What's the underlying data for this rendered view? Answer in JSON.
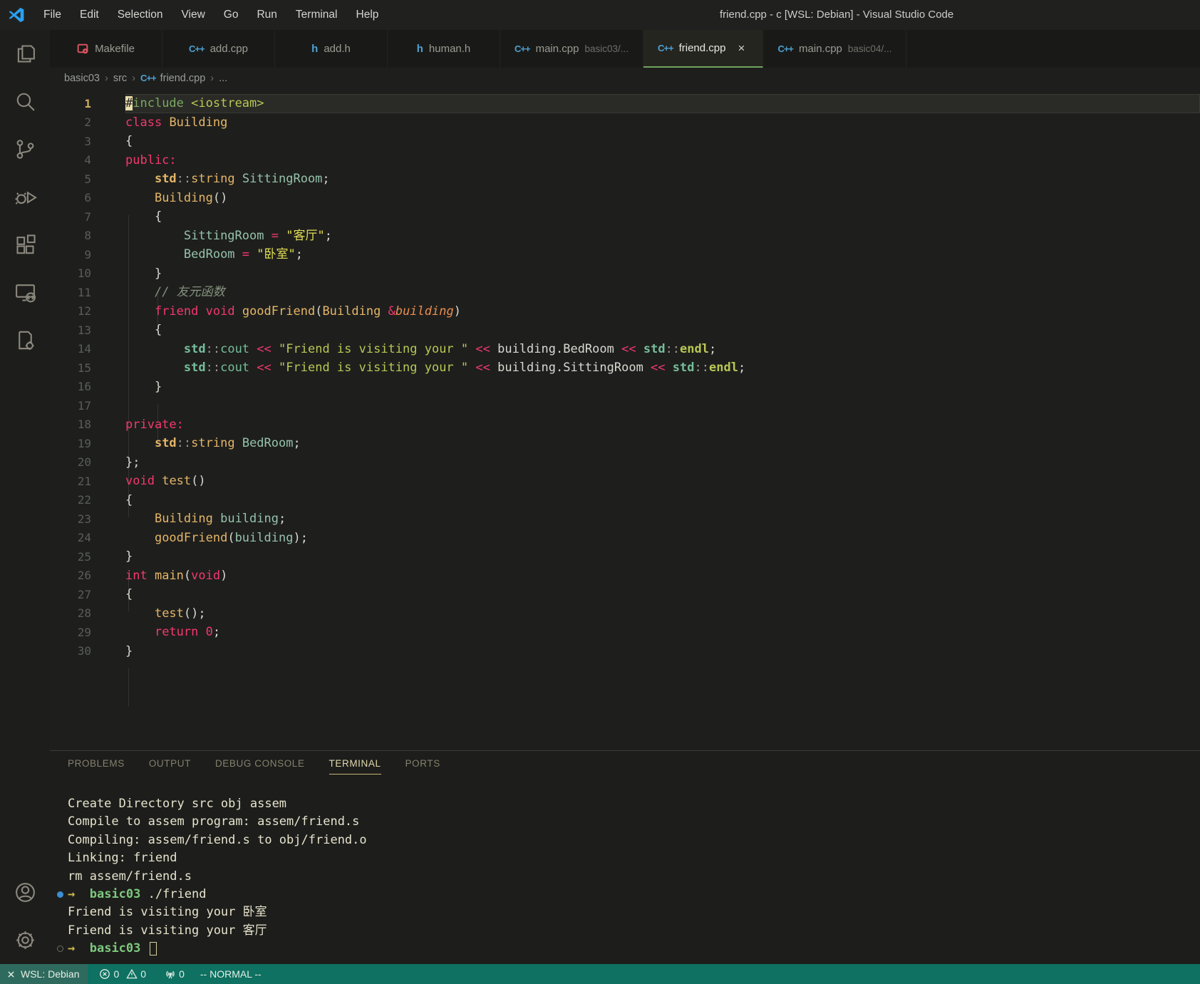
{
  "window": {
    "title": "friend.cpp - c [WSL: Debian] - Visual Studio Code"
  },
  "menus": [
    "File",
    "Edit",
    "Selection",
    "View",
    "Go",
    "Run",
    "Terminal",
    "Help"
  ],
  "activity_bar": {
    "top": [
      "explorer",
      "search",
      "source-control",
      "run-debug",
      "extensions",
      "remote-explorer",
      "cpp-tools"
    ],
    "bottom": [
      "accounts",
      "settings"
    ]
  },
  "tabs": [
    {
      "icon": "makefile",
      "label": "Makefile"
    },
    {
      "icon": "cpp",
      "label": "add.cpp"
    },
    {
      "icon": "h",
      "label": "add.h"
    },
    {
      "icon": "h",
      "label": "human.h"
    },
    {
      "icon": "cpp",
      "label": "main.cpp",
      "desc": "basic03/..."
    },
    {
      "icon": "cpp",
      "label": "friend.cpp",
      "active": true,
      "close": "×"
    },
    {
      "icon": "cpp",
      "label": "main.cpp",
      "desc": "basic04/..."
    }
  ],
  "breadcrumb": {
    "items": [
      {
        "label": "basic03"
      },
      {
        "label": "src"
      },
      {
        "label": "friend.cpp",
        "icon": "cpp"
      },
      {
        "label": "..."
      }
    ],
    "separator": "›"
  },
  "editor": {
    "first_line_number": 1,
    "current_line": 1,
    "lines": [
      [
        [
          "cur",
          "#"
        ],
        [
          "gr",
          "include"
        ],
        [
          "w",
          " "
        ],
        [
          "yg",
          "<iostream>"
        ]
      ],
      [
        [
          "r",
          "class"
        ],
        [
          "w",
          " "
        ],
        [
          "g",
          "Building"
        ]
      ],
      [
        [
          "w",
          "{"
        ]
      ],
      [
        [
          "r",
          "public:"
        ]
      ],
      [
        [
          "w",
          "    "
        ],
        [
          "gb",
          "std"
        ],
        [
          "gy",
          "::"
        ],
        [
          "g",
          "string"
        ],
        [
          "w",
          " "
        ],
        [
          "t",
          "SittingRoom"
        ],
        [
          "w",
          ";"
        ]
      ],
      [
        [
          "w",
          "    "
        ],
        [
          "g",
          "Building"
        ],
        [
          "w",
          "()"
        ]
      ],
      [
        [
          "w",
          "    {"
        ]
      ],
      [
        [
          "w",
          "        "
        ],
        [
          "t",
          "SittingRoom"
        ],
        [
          "w",
          " "
        ],
        [
          "r",
          "="
        ],
        [
          "w",
          " "
        ],
        [
          "y",
          "\"客厅\""
        ],
        [
          "w",
          ";"
        ]
      ],
      [
        [
          "w",
          "        "
        ],
        [
          "t",
          "BedRoom"
        ],
        [
          "w",
          " "
        ],
        [
          "r",
          "="
        ],
        [
          "w",
          " "
        ],
        [
          "y",
          "\"卧室\""
        ],
        [
          "w",
          ";"
        ]
      ],
      [
        [
          "w",
          "    }"
        ]
      ],
      [
        [
          "w",
          "    "
        ],
        [
          "c",
          "// 友元函数"
        ]
      ],
      [
        [
          "w",
          "    "
        ],
        [
          "r",
          "friend"
        ],
        [
          "w",
          " "
        ],
        [
          "r",
          "void"
        ],
        [
          "w",
          " "
        ],
        [
          "g",
          "goodFriend"
        ],
        [
          "w",
          "("
        ],
        [
          "g",
          "Building"
        ],
        [
          "w",
          " "
        ],
        [
          "r",
          "&"
        ],
        [
          "o",
          "building"
        ],
        [
          "w",
          ")"
        ]
      ],
      [
        [
          "w",
          "    {"
        ]
      ],
      [
        [
          "w",
          "        "
        ],
        [
          "nb",
          "std"
        ],
        [
          "gy",
          "::"
        ],
        [
          "n",
          "cout"
        ],
        [
          "w",
          " "
        ],
        [
          "r",
          "<<"
        ],
        [
          "w",
          " "
        ],
        [
          "yg",
          "\"Friend is visiting your \""
        ],
        [
          "w",
          " "
        ],
        [
          "r",
          "<<"
        ],
        [
          "w",
          " building.BedRoom "
        ],
        [
          "r",
          "<<"
        ],
        [
          "w",
          " "
        ],
        [
          "nb",
          "std"
        ],
        [
          "gy",
          "::"
        ],
        [
          "ygb",
          "endl"
        ],
        [
          "w",
          ";"
        ]
      ],
      [
        [
          "w",
          "        "
        ],
        [
          "nb",
          "std"
        ],
        [
          "gy",
          "::"
        ],
        [
          "n",
          "cout"
        ],
        [
          "w",
          " "
        ],
        [
          "r",
          "<<"
        ],
        [
          "w",
          " "
        ],
        [
          "yg",
          "\"Friend is visiting your \""
        ],
        [
          "w",
          " "
        ],
        [
          "r",
          "<<"
        ],
        [
          "w",
          " building.SittingRoom "
        ],
        [
          "r",
          "<<"
        ],
        [
          "w",
          " "
        ],
        [
          "nb",
          "std"
        ],
        [
          "gy",
          "::"
        ],
        [
          "ygb",
          "endl"
        ],
        [
          "w",
          ";"
        ]
      ],
      [
        [
          "w",
          "    }"
        ]
      ],
      [],
      [
        [
          "r",
          "private:"
        ]
      ],
      [
        [
          "w",
          "    "
        ],
        [
          "gb",
          "std"
        ],
        [
          "gy",
          "::"
        ],
        [
          "g",
          "string"
        ],
        [
          "w",
          " "
        ],
        [
          "t",
          "BedRoom"
        ],
        [
          "w",
          ";"
        ]
      ],
      [
        [
          "w",
          "};"
        ]
      ],
      [
        [
          "r",
          "void"
        ],
        [
          "w",
          " "
        ],
        [
          "g",
          "test"
        ],
        [
          "w",
          "()"
        ]
      ],
      [
        [
          "w",
          "{"
        ]
      ],
      [
        [
          "w",
          "    "
        ],
        [
          "g",
          "Building"
        ],
        [
          "w",
          " "
        ],
        [
          "t",
          "building"
        ],
        [
          "w",
          ";"
        ]
      ],
      [
        [
          "w",
          "    "
        ],
        [
          "g",
          "goodFriend"
        ],
        [
          "w",
          "("
        ],
        [
          "t",
          "building"
        ],
        [
          "w",
          ");"
        ]
      ],
      [
        [
          "w",
          "}"
        ]
      ],
      [
        [
          "r",
          "int"
        ],
        [
          "w",
          " "
        ],
        [
          "g",
          "main"
        ],
        [
          "w",
          "("
        ],
        [
          "r",
          "void"
        ],
        [
          "w",
          ")"
        ]
      ],
      [
        [
          "w",
          "{"
        ]
      ],
      [
        [
          "w",
          "    "
        ],
        [
          "g",
          "test"
        ],
        [
          "w",
          "();"
        ]
      ],
      [
        [
          "w",
          "    "
        ],
        [
          "r",
          "return"
        ],
        [
          "w",
          " "
        ],
        [
          "r",
          "0"
        ],
        [
          "w",
          ";"
        ]
      ],
      [
        [
          "w",
          "}"
        ]
      ]
    ]
  },
  "panel": {
    "tabs": [
      {
        "label": "PROBLEMS"
      },
      {
        "label": "OUTPUT"
      },
      {
        "label": "DEBUG CONSOLE"
      },
      {
        "label": "TERMINAL",
        "active": true
      },
      {
        "label": "PORTS"
      }
    ]
  },
  "terminal": {
    "lines": [
      {
        "segs": [
          [
            "tw",
            "Create Directory src obj assem"
          ]
        ]
      },
      {
        "segs": [
          [
            "tw",
            "Compile to assem program: assem/friend.s"
          ]
        ]
      },
      {
        "segs": [
          [
            "tw",
            "Compiling: assem/friend.s to obj/friend.o"
          ]
        ]
      },
      {
        "segs": [
          [
            "tw",
            "Linking: friend"
          ]
        ]
      },
      {
        "segs": [
          [
            "tw",
            "rm assem/friend.s"
          ]
        ]
      },
      {
        "deco": "filled",
        "segs": [
          [
            "t-arrow",
            "→"
          ],
          [
            "tw",
            "  "
          ],
          [
            "t-dir",
            "basic03"
          ],
          [
            "tw",
            " ./friend"
          ]
        ]
      },
      {
        "segs": [
          [
            "tw",
            "Friend is visiting your 卧室"
          ]
        ]
      },
      {
        "segs": [
          [
            "tw",
            "Friend is visiting your 客厅"
          ]
        ]
      },
      {
        "deco": "hollow",
        "cursor": true,
        "segs": [
          [
            "t-arrow",
            "→"
          ],
          [
            "tw",
            "  "
          ],
          [
            "t-dir",
            "basic03"
          ],
          [
            "tw",
            " "
          ]
        ]
      }
    ]
  },
  "status_bar": {
    "remote": "WSL: Debian",
    "errors": "0",
    "warnings": "0",
    "radio": "0",
    "mode": "-- NORMAL --"
  },
  "colors": {
    "status_bar": "#0e7162",
    "remote_segment": "#2f6a5e",
    "active_tab_indicator": "#71a35f",
    "terminal_prompt_dir": "#7ec87e",
    "terminal_decoration": "#3c8ed3",
    "cursor_block": "#e8ddae"
  }
}
